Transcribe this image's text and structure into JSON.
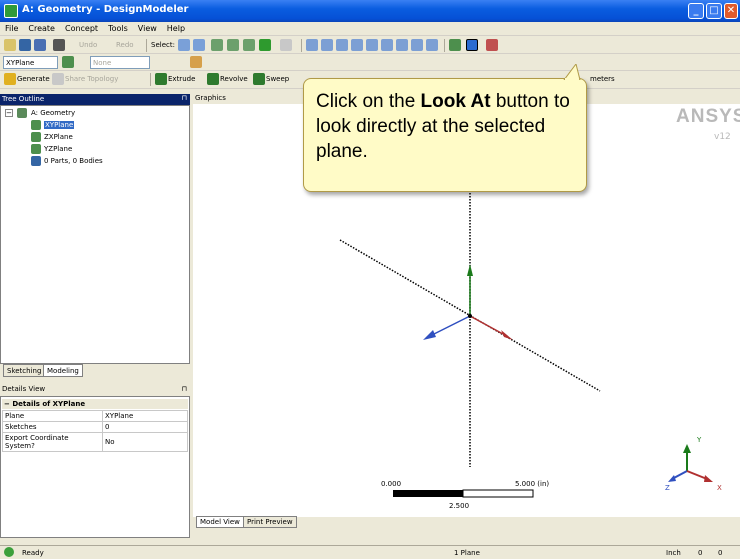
{
  "window": {
    "title": "A: Geometry - DesignModeler",
    "min": "_",
    "max": "□",
    "close": "✕"
  },
  "menu": [
    "File",
    "Create",
    "Concept",
    "Tools",
    "View",
    "Help"
  ],
  "toolbar1": {
    "undo": "Undo",
    "redo": "Redo",
    "select": "Select:"
  },
  "toolbar2": {
    "plane_combo": "XYPlane",
    "sketch_combo": "None"
  },
  "toolbar3": {
    "generate": "Generate",
    "share_topology": "Share Topology",
    "extrude": "Extrude",
    "revolve": "Revolve",
    "sweep": "Sweep",
    "parameters": "meters"
  },
  "tree": {
    "title": "Tree Outline",
    "pin": "⊓",
    "root": "A: Geometry",
    "items": [
      "XYPlane",
      "ZXPlane",
      "YZPlane",
      "0 Parts, 0 Bodies"
    ]
  },
  "panel_tabs": [
    "Sketching",
    "Modeling"
  ],
  "details": {
    "title": "Details View",
    "pin": "⊓",
    "section": "Details of XYPlane",
    "rows": [
      [
        "Plane",
        "XYPlane"
      ],
      [
        "Sketches",
        "0"
      ],
      [
        "Export Coordinate System?",
        "No"
      ]
    ]
  },
  "graphics": {
    "title": "Graphics",
    "logo": "ANSYS",
    "version": "v12",
    "scale_start": "0.000",
    "scale_mid": "2.500",
    "scale_end": "5.000 (in)"
  },
  "axis_labels": {
    "y": "Y",
    "z": "Z",
    "x": "X"
  },
  "callout": {
    "prefix": "Click on the ",
    "bold": "Look At",
    "rest": " button to look directly at the selected plane."
  },
  "bottom_tabs": [
    "Model View",
    "Print Preview"
  ],
  "status": {
    "state": "Ready",
    "selection": "1 Plane",
    "units": "Inch",
    "v1": "0",
    "v2": "0"
  }
}
